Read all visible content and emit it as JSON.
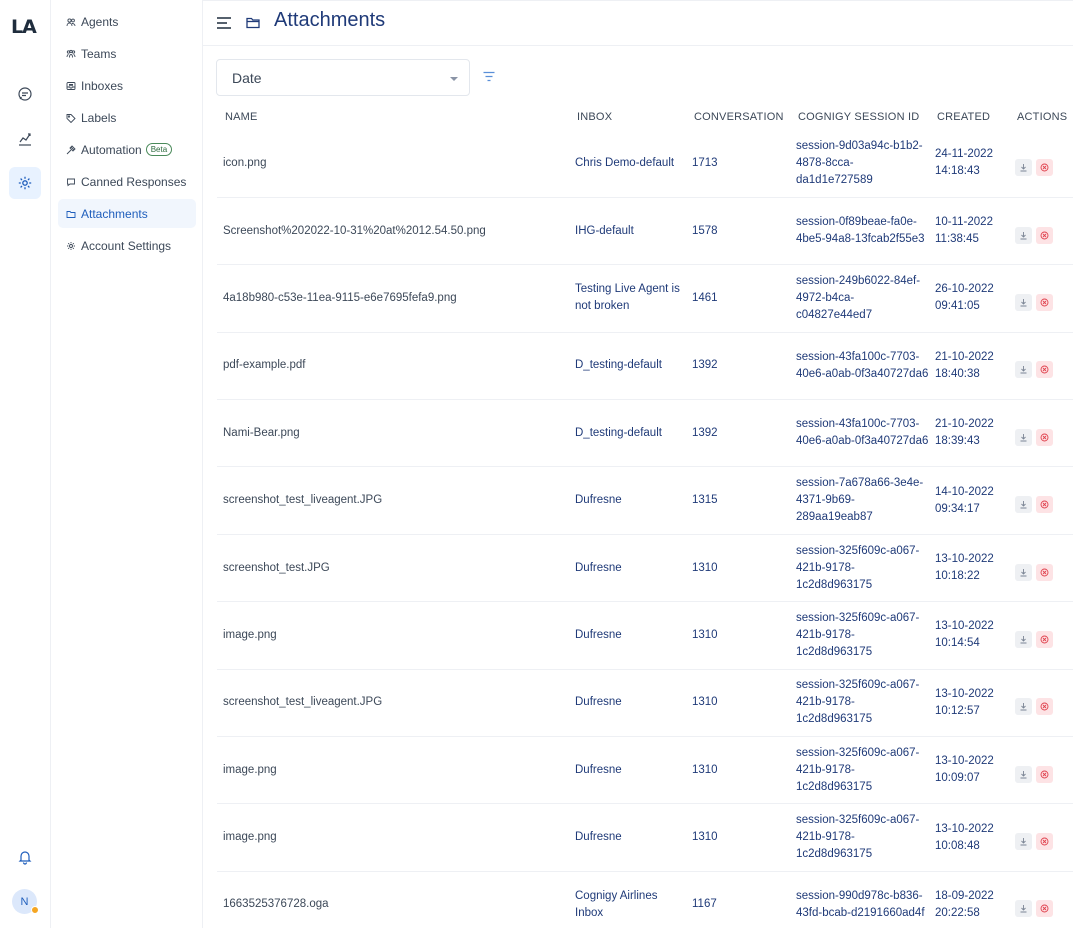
{
  "app": {
    "logo": "LA"
  },
  "rail": {
    "icons": [
      "chat-icon",
      "reports-icon",
      "settings-icon",
      "bell-icon"
    ],
    "avatar_initial": "N"
  },
  "subnav": {
    "items": [
      {
        "label": "Agents",
        "icon": "agents-icon"
      },
      {
        "label": "Teams",
        "icon": "teams-icon"
      },
      {
        "label": "Inboxes",
        "icon": "inbox-icon"
      },
      {
        "label": "Labels",
        "icon": "label-icon"
      },
      {
        "label": "Automation",
        "icon": "automation-icon",
        "badge": "Beta"
      },
      {
        "label": "Canned Responses",
        "icon": "canned-icon"
      },
      {
        "label": "Attachments",
        "icon": "folder-icon",
        "active": true
      },
      {
        "label": "Account Settings",
        "icon": "gear-icon"
      }
    ]
  },
  "header": {
    "title": "Attachments"
  },
  "filter": {
    "selected": "Date"
  },
  "table": {
    "columns": [
      "NAME",
      "INBOX",
      "CONVERSATION",
      "COGNIGY SESSION ID",
      "CREATED",
      "ACTIONS"
    ],
    "rows": [
      {
        "name": "icon.png",
        "inbox": "Chris Demo-default",
        "conversation": "1713",
        "session": "session-9d03a94c-b1b2-4878-8cca-da1d1e727589",
        "created": "24-11-2022 14:18:43"
      },
      {
        "name": "Screenshot%202022-10-31%20at%2012.54.50.png",
        "inbox": "IHG-default",
        "conversation": "1578",
        "session": "session-0f89beae-fa0e-4be5-94a8-13fcab2f55e3",
        "created": "10-11-2022 11:38:45"
      },
      {
        "name": "4a18b980-c53e-11ea-9115-e6e7695fefa9.png",
        "inbox": "Testing Live Agent is not broken",
        "conversation": "1461",
        "session": "session-249b6022-84ef-4972-b4ca-c04827e44ed7",
        "created": "26-10-2022 09:41:05"
      },
      {
        "name": "pdf-example.pdf",
        "inbox": "D_testing-default",
        "conversation": "1392",
        "session": "session-43fa100c-7703-40e6-a0ab-0f3a40727da6",
        "created": "21-10-2022 18:40:38"
      },
      {
        "name": "Nami-Bear.png",
        "inbox": "D_testing-default",
        "conversation": "1392",
        "session": "session-43fa100c-7703-40e6-a0ab-0f3a40727da6",
        "created": "21-10-2022 18:39:43"
      },
      {
        "name": "screenshot_test_liveagent.JPG",
        "inbox": "Dufresne",
        "conversation": "1315",
        "session": "session-7a678a66-3e4e-4371-9b69-289aa19eab87",
        "created": "14-10-2022 09:34:17"
      },
      {
        "name": "screenshot_test.JPG",
        "inbox": "Dufresne",
        "conversation": "1310",
        "session": "session-325f609c-a067-421b-9178-1c2d8d963175",
        "created": "13-10-2022 10:18:22"
      },
      {
        "name": "image.png",
        "inbox": "Dufresne",
        "conversation": "1310",
        "session": "session-325f609c-a067-421b-9178-1c2d8d963175",
        "created": "13-10-2022 10:14:54"
      },
      {
        "name": "screenshot_test_liveagent.JPG",
        "inbox": "Dufresne",
        "conversation": "1310",
        "session": "session-325f609c-a067-421b-9178-1c2d8d963175",
        "created": "13-10-2022 10:12:57"
      },
      {
        "name": "image.png",
        "inbox": "Dufresne",
        "conversation": "1310",
        "session": "session-325f609c-a067-421b-9178-1c2d8d963175",
        "created": "13-10-2022 10:09:07"
      },
      {
        "name": "image.png",
        "inbox": "Dufresne",
        "conversation": "1310",
        "session": "session-325f609c-a067-421b-9178-1c2d8d963175",
        "created": "13-10-2022 10:08:48"
      },
      {
        "name": "1663525376728.oga",
        "inbox": "Cognigy Airlines Inbox",
        "conversation": "1167",
        "session": "session-990d978c-b836-43fd-bcab-d2191660ad4f",
        "created": "18-09-2022 20:22:58"
      }
    ]
  },
  "colors": {
    "accent": "#1f5ebc",
    "title": "#1f3a78",
    "delete_bg": "#fde3e5",
    "delete_icon": "#e0434f"
  }
}
